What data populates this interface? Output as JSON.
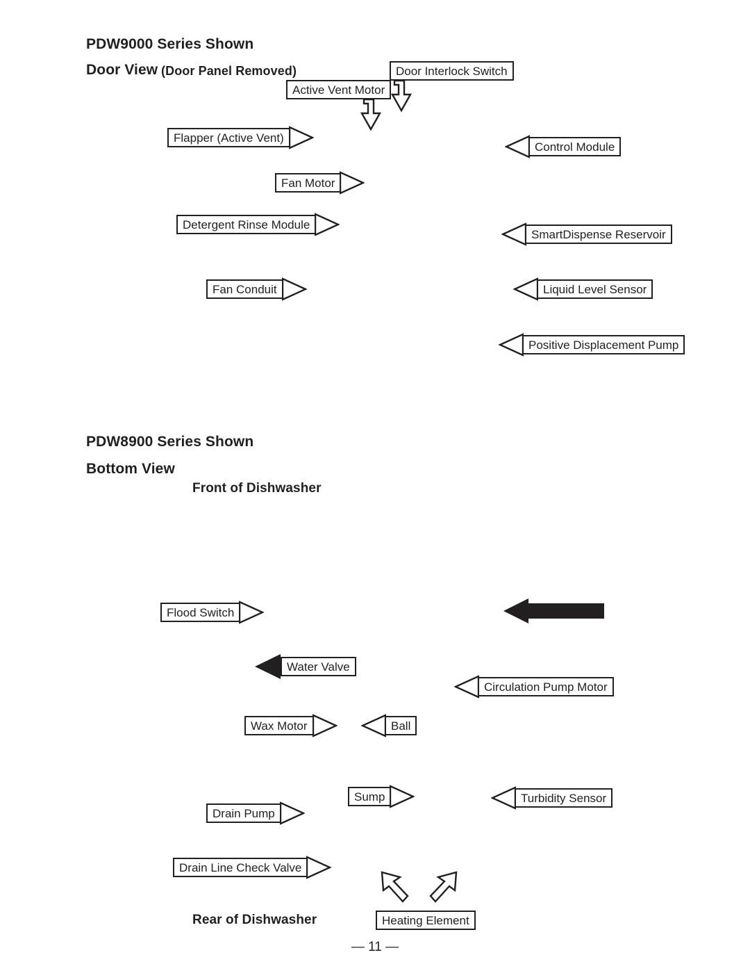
{
  "page": {
    "folio": "— 11 —"
  },
  "section_door": {
    "series_title": "PDW9000 Series Shown",
    "view_title": "Door View",
    "view_note": "(Door Panel Removed)",
    "callouts": [
      {
        "label": "Door Interlock Switch",
        "direction": "down"
      },
      {
        "label": "Active Vent Motor",
        "direction": "down"
      },
      {
        "label": "Flapper (Active Vent)",
        "direction": "right"
      },
      {
        "label": "Control Module",
        "direction": "left"
      },
      {
        "label": "Fan Motor",
        "direction": "right"
      },
      {
        "label": "Detergent Rinse Module",
        "direction": "right"
      },
      {
        "label": "SmartDispense Reservoir",
        "direction": "left"
      },
      {
        "label": "Fan Conduit",
        "direction": "right"
      },
      {
        "label": "Liquid Level Sensor",
        "direction": "left"
      },
      {
        "label": "Positive Displacement Pump",
        "direction": "left"
      }
    ]
  },
  "section_bottom": {
    "series_title": "PDW8900 Series Shown",
    "view_title": "Bottom View",
    "front_label": "Front of Dishwasher",
    "rear_label": "Rear of Dishwasher",
    "callouts": [
      {
        "label": "Flood Switch",
        "direction": "right"
      },
      {
        "label": "Water Valve",
        "direction": "left-solid"
      },
      {
        "label": "Circulation Pump Motor",
        "direction": "left"
      },
      {
        "label": "Wax Motor",
        "direction": "right"
      },
      {
        "label": "Ball",
        "direction": "left"
      },
      {
        "label": "Sump",
        "direction": "right"
      },
      {
        "label": "Turbidity Sensor",
        "direction": "left"
      },
      {
        "label": "Drain Pump",
        "direction": "right"
      },
      {
        "label": "Drain Line Check Valve",
        "direction": "right"
      },
      {
        "label": "Heating Element",
        "direction": "up-double"
      }
    ],
    "unlabeled_arrow": "solid-left-arrow"
  }
}
